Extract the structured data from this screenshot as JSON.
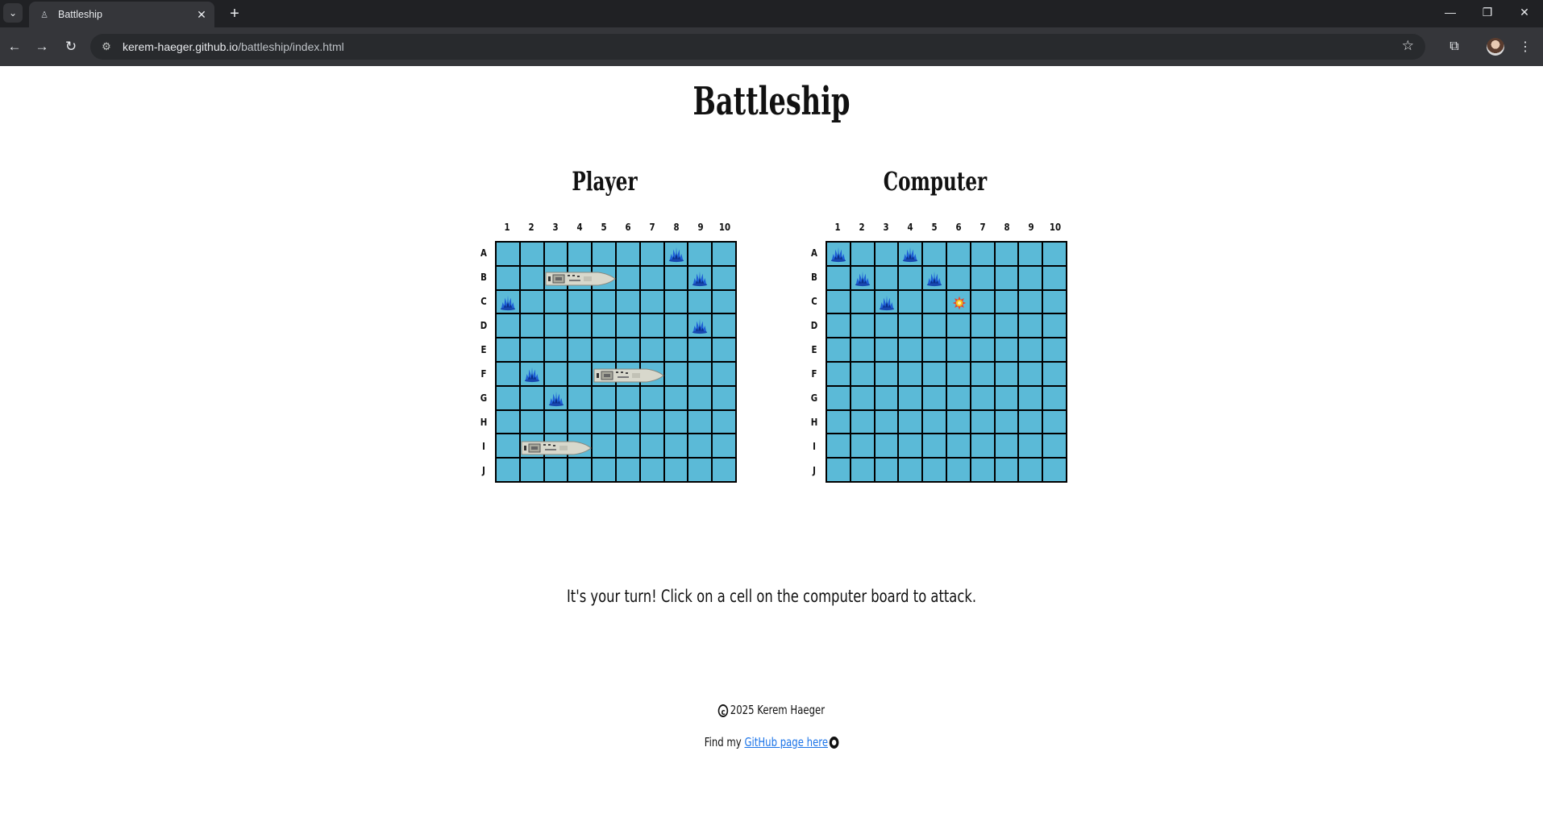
{
  "browser": {
    "tab_title": "Battleship",
    "url_host": "kerem-haeger.github.io",
    "url_path": "/battleship/index.html"
  },
  "page": {
    "title": "Battleship",
    "player_heading": "Player",
    "computer_heading": "Computer",
    "status": "It's your turn! Click on a cell on the computer board to attack.",
    "copyright": "2025 Kerem Haeger",
    "footer_prefix": "Find my ",
    "footer_link": "GitHub page here"
  },
  "board": {
    "columns": [
      "1",
      "2",
      "3",
      "4",
      "5",
      "6",
      "7",
      "8",
      "9",
      "10"
    ],
    "rows": [
      "A",
      "B",
      "C",
      "D",
      "E",
      "F",
      "G",
      "H",
      "I",
      "J"
    ],
    "cell_color": "#5bbad7",
    "grid_color": "#000000"
  },
  "player_board": {
    "misses": [
      "A8",
      "B9",
      "C1",
      "D9",
      "F2",
      "G3"
    ],
    "ships": [
      {
        "start": "B3",
        "length": 3,
        "orientation": "horizontal"
      },
      {
        "start": "F5",
        "length": 3,
        "orientation": "horizontal"
      },
      {
        "start": "I2",
        "length": 3,
        "orientation": "horizontal"
      }
    ]
  },
  "computer_board": {
    "misses": [
      "A1",
      "A4",
      "B2",
      "B5",
      "C3"
    ],
    "hits": [
      "C6"
    ]
  },
  "icons": {
    "miss": "splash-icon",
    "hit": "fire-icon"
  }
}
